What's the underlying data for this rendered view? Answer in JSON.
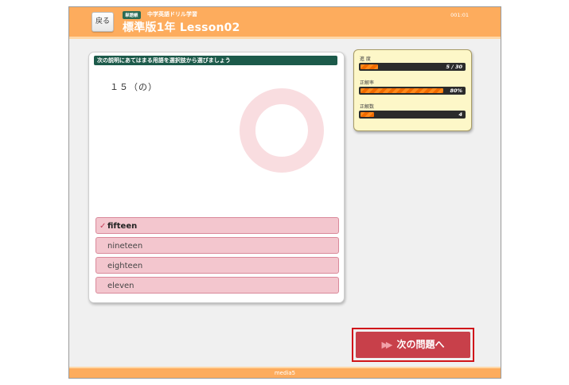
{
  "header": {
    "back_label": "戻る",
    "tag": "単語帳",
    "series": "中学英語ドリル学習",
    "title": "標準版1年 Lesson02",
    "code": "001:01"
  },
  "question": {
    "instruction": "次の説明にあてはまる用語を選択肢から選びましょう",
    "prompt": "１５（の）",
    "choices": [
      {
        "label": "fifteen",
        "checked": true,
        "check_mark": "✓"
      },
      {
        "label": "nineteen"
      },
      {
        "label": "eighteen"
      },
      {
        "label": "eleven"
      }
    ]
  },
  "stats": {
    "progress": {
      "label": "進 度",
      "value": "5 / 30",
      "fraction": 0.1667
    },
    "accuracy": {
      "label": "正解率",
      "value": "80%",
      "fraction": 0.8
    },
    "correct": {
      "label": "正解数",
      "value": "4",
      "fraction": 0.1333
    }
  },
  "next_button": {
    "arrows": "▶▶",
    "label": "次の問題へ"
  },
  "footer": {
    "logo": "media5"
  },
  "colors": {
    "header": "#fdac5d",
    "choice": "#f3c6ce",
    "next": "#c8404a",
    "accent_border": "#d0141a"
  }
}
